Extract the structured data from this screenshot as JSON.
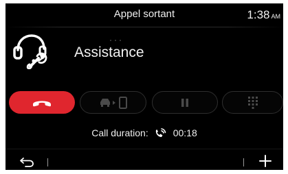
{
  "header": {
    "title": "Appel sortant",
    "time": "1:38",
    "ampm": "AM"
  },
  "contact": {
    "name": "Assistance",
    "icon": "headset-wrench-icon"
  },
  "call_controls": [
    {
      "name": "hang-up-button",
      "icon": "phone-hangup-icon",
      "active": true
    },
    {
      "name": "transfer-to-phone-button",
      "icon": "car-to-phone-icon",
      "active": false
    },
    {
      "name": "hold-button",
      "icon": "pause-icon",
      "active": false
    },
    {
      "name": "keypad-button",
      "icon": "keypad-icon",
      "active": false
    }
  ],
  "status": {
    "label": "Call duration:",
    "duration": "00:18"
  },
  "colors": {
    "background": "#000000",
    "hangup": "#e0262e",
    "text": "#f0f0f0",
    "disabled_icon": "#4a4a4a"
  }
}
